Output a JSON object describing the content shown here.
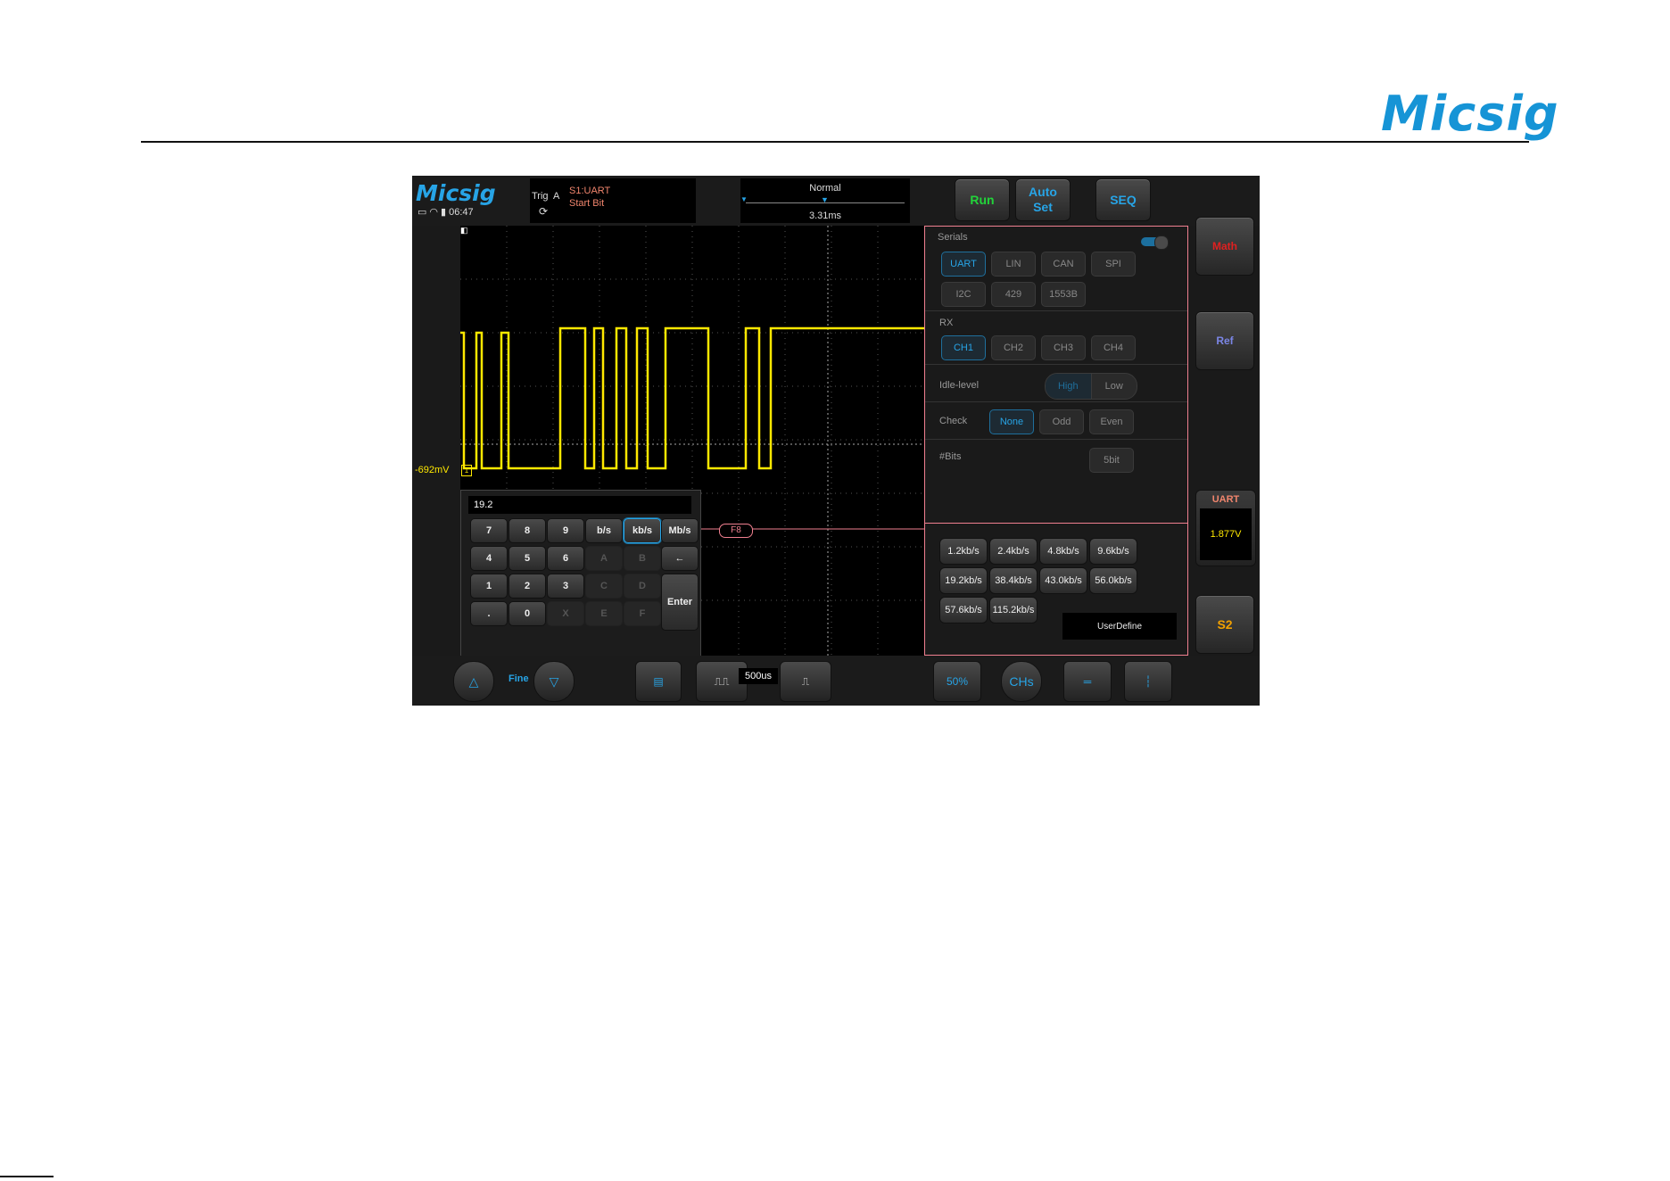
{
  "doc": {
    "logo": "Micsig"
  },
  "topbar": {
    "brand": "Micsig",
    "time": "06:47",
    "trigger": {
      "label": "Trig",
      "source": "A",
      "edge_icon": "⟳",
      "serial": "S1:UART",
      "type": "Start Bit"
    },
    "timebase": {
      "mode": "Normal",
      "position": "3.31ms"
    },
    "buttons": {
      "run": "Run",
      "auto": "Auto\nSet",
      "seq": "SEQ"
    }
  },
  "sidebar": {
    "math": "Math",
    "ref": "Ref",
    "uart_title": "UART",
    "uart_value": "1.877V",
    "s2": "S2"
  },
  "waveform": {
    "ch_offset": "-692mV",
    "ch_marker": "1",
    "cursor_tag": "F8"
  },
  "keypad": {
    "value": "19.2",
    "keys": [
      {
        "label": "7",
        "state": "normal"
      },
      {
        "label": "8",
        "state": "normal"
      },
      {
        "label": "9",
        "state": "normal"
      },
      {
        "label": "b/s",
        "state": "normal"
      },
      {
        "label": "kb/s",
        "state": "selected"
      },
      {
        "label": "Mb/s",
        "state": "normal"
      },
      {
        "label": "4",
        "state": "normal"
      },
      {
        "label": "5",
        "state": "normal"
      },
      {
        "label": "6",
        "state": "normal"
      },
      {
        "label": "A",
        "state": "disabled"
      },
      {
        "label": "B",
        "state": "disabled"
      },
      {
        "label": "←",
        "state": "normal"
      },
      {
        "label": "1",
        "state": "normal"
      },
      {
        "label": "2",
        "state": "normal"
      },
      {
        "label": "3",
        "state": "normal"
      },
      {
        "label": "C",
        "state": "disabled"
      },
      {
        "label": "D",
        "state": "disabled"
      },
      {
        "label": ".",
        "state": "normal"
      },
      {
        "label": "0",
        "state": "normal"
      },
      {
        "label": "X",
        "state": "disabled"
      },
      {
        "label": "E",
        "state": "disabled"
      },
      {
        "label": "F",
        "state": "disabled"
      }
    ],
    "enter": "Enter"
  },
  "panel": {
    "serials_label": "Serials",
    "serials": [
      "UART",
      "LIN",
      "CAN",
      "SPI",
      "I2C",
      "429",
      "1553B"
    ],
    "serial_active": 0,
    "rx_label": "RX",
    "rx": [
      "CH1",
      "CH2",
      "CH3",
      "CH4"
    ],
    "rx_active": 0,
    "idle_label": "Idle-level",
    "idle": [
      "High",
      "Low"
    ],
    "check_label": "Check",
    "check": [
      "None",
      "Odd",
      "Even"
    ],
    "bits_label": "#Bits",
    "bits_value": "5bit",
    "bauds": [
      "1.2kb/s",
      "2.4kb/s",
      "4.8kb/s",
      "9.6kb/s",
      "19.2kb/s",
      "38.4kb/s",
      "43.0kb/s",
      "56.0kb/s",
      "57.6kb/s",
      "115.2kb/s"
    ],
    "user_define": "UserDefine"
  },
  "bottombar": {
    "fine": "Fine",
    "timebase": "500us",
    "ch1_btn": "50%",
    "ch2_btn": "CHs"
  }
}
